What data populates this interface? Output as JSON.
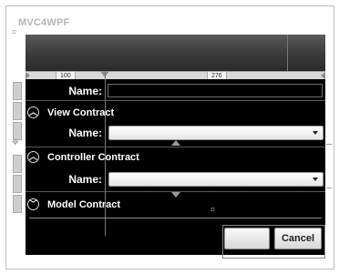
{
  "window": {
    "title": "MVC4WPF"
  },
  "ruler": {
    "left_label": "100",
    "right_label": "276"
  },
  "name_row": {
    "label": "Name:",
    "value": ""
  },
  "sections": [
    {
      "label": "View Contract",
      "field_label": "Name:",
      "selected": ""
    },
    {
      "label": "Controller Contract",
      "field_label": "Name:",
      "selected": ""
    },
    {
      "label": "Model Contract"
    }
  ],
  "buttons": {
    "ok_label": "",
    "cancel_label": "Cancel"
  },
  "colors": {
    "panel": "#000000",
    "header": "#3a3a3a",
    "text": "#ffffff"
  },
  "icons": [
    "collapse-chevron-icon",
    "move-handle-icon",
    "dropdown-arrow-icon"
  ]
}
